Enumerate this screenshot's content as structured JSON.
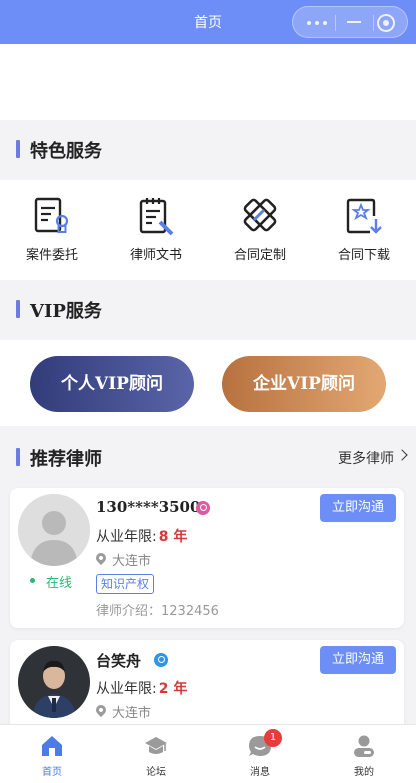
{
  "topbar": {
    "title": "首页"
  },
  "sections": {
    "featured": "特色服务",
    "vip": "VIP服务",
    "recommended": "推荐律师",
    "more_lawyers": "更多律师"
  },
  "services": [
    {
      "label": "案件委托",
      "icon": "case-document-icon"
    },
    {
      "label": "律师文书",
      "icon": "lawyer-document-icon"
    },
    {
      "label": "合同定制",
      "icon": "contract-pencil-icon"
    },
    {
      "label": "合同下载",
      "icon": "contract-download-icon"
    }
  ],
  "vip": {
    "personal": "个人VIP顾问",
    "enterprise": "企业VIP顾问"
  },
  "lawyers": [
    {
      "name": "130****3500",
      "gender": "female",
      "years_label": "从业年限:",
      "years_value": "8 年",
      "city": "大连市",
      "status": "在线",
      "tag": "知识产权",
      "intro": "律师介绍：1232456",
      "chat": "立即沟通"
    },
    {
      "name": "台笑舟",
      "gender": "male",
      "years_label": "从业年限:",
      "years_value": "2 年",
      "city": "大连市",
      "chat": "立即沟通"
    }
  ],
  "tabbar": [
    {
      "label": "首页",
      "icon": "home-icon",
      "active": true
    },
    {
      "label": "论坛",
      "icon": "forum-graduation-cap-icon"
    },
    {
      "label": "消息",
      "icon": "message-bubble-icon",
      "badge": "1"
    },
    {
      "label": "我的",
      "icon": "profile-icon"
    }
  ],
  "colors": {
    "primary": "#6d8ef7",
    "accent_bar": "#6e7be6",
    "vip_personal": "#3d4685",
    "vip_enterprise": "#cf8b55",
    "highlight_red": "#d23a3a",
    "online_green": "#2bb673"
  }
}
